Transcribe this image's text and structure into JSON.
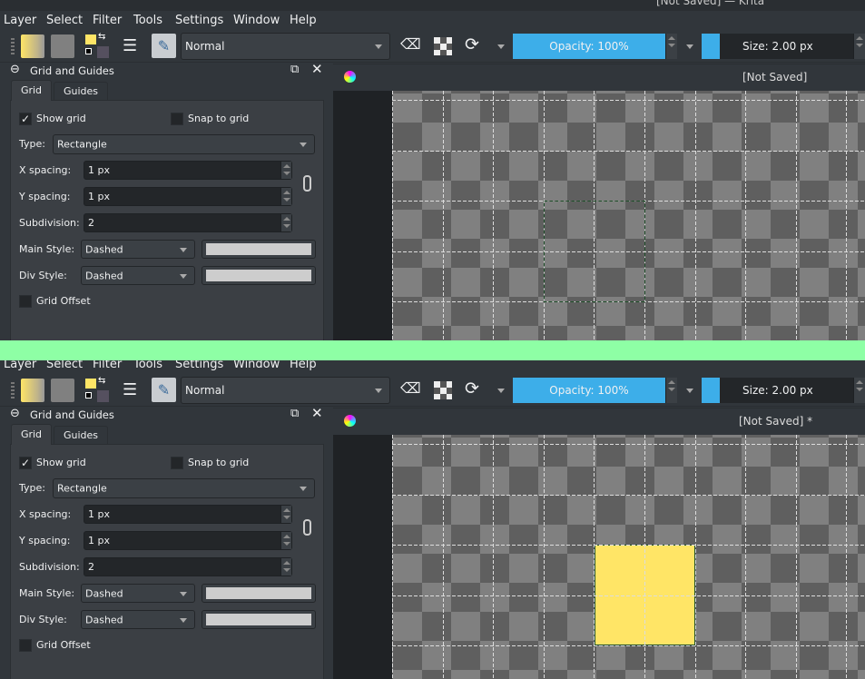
{
  "screens": [
    {
      "window_title": "[Not Saved] — Krita",
      "menu": [
        "Layer",
        "Select",
        "Filter",
        "Tools",
        "Settings",
        "Window",
        "Help"
      ],
      "toolbar": {
        "blend_mode": "Normal",
        "opacity": "Opacity: 100%",
        "opacity_value": 100,
        "size": "Size: 2.00 px",
        "accent": "#3daee9"
      },
      "docker": {
        "title": "Grid and Guides",
        "tabs": [
          "Grid",
          "Guides"
        ],
        "show_grid": "Show grid",
        "show_grid_checked": true,
        "snap_to_grid": "Snap to grid",
        "snap_checked": false,
        "type_label": "Type:",
        "type_value": "Rectangle",
        "x_label": "X spacing:",
        "x_value": "1 px",
        "y_label": "Y spacing:",
        "y_value": "1 px",
        "sub_label": "Subdivision:",
        "sub_value": "2",
        "main_label": "Main Style:",
        "main_value": "Dashed",
        "div_label": "Div Style:",
        "div_value": "Dashed",
        "offset_label": "Grid Offset",
        "offset_checked": false,
        "grid_color": "#cdcdcd"
      },
      "canvas": {
        "title": "[Not Saved]",
        "content": "selection",
        "fill_color": "#ffe566"
      }
    },
    {
      "window_title": "",
      "menu": [
        "Layer",
        "Select",
        "Filter",
        "Tools",
        "Settings",
        "Window",
        "Help"
      ],
      "toolbar": {
        "blend_mode": "Normal",
        "opacity": "Opacity: 100%",
        "opacity_value": 100,
        "size": "Size: 2.00 px",
        "accent": "#3daee9"
      },
      "docker": {
        "title": "Grid and Guides",
        "tabs": [
          "Grid",
          "Guides"
        ],
        "show_grid": "Show grid",
        "show_grid_checked": true,
        "snap_to_grid": "Snap to grid",
        "snap_checked": false,
        "type_label": "Type:",
        "type_value": "Rectangle",
        "x_label": "X spacing:",
        "x_value": "1 px",
        "y_label": "Y spacing:",
        "y_value": "1 px",
        "sub_label": "Subdivision:",
        "sub_value": "2",
        "main_label": "Main Style:",
        "main_value": "Dashed",
        "div_label": "Div Style:",
        "div_value": "Dashed",
        "offset_label": "Grid Offset",
        "offset_checked": false,
        "grid_color": "#cdcdcd"
      },
      "canvas": {
        "title": "[Not Saved]  *",
        "content": "filled",
        "fill_color": "#ffe566"
      }
    }
  ]
}
